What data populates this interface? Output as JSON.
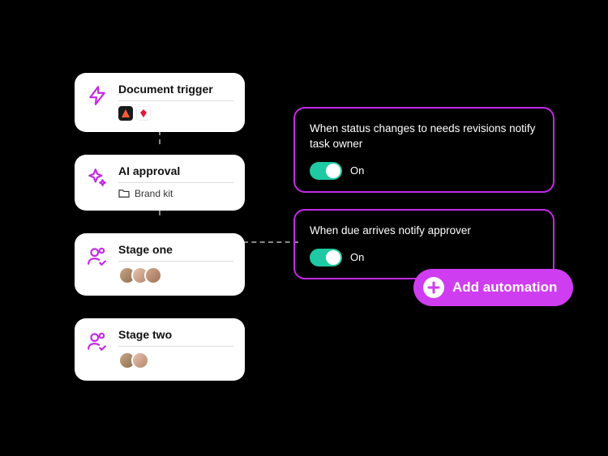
{
  "colors": {
    "accent": "#c528e8",
    "toggle_on": "#1ec9a3",
    "pill": "#cf3df0"
  },
  "stages": [
    {
      "title": "Document trigger",
      "icon": "lightning-icon",
      "meta_type": "apps"
    },
    {
      "title": "AI approval",
      "icon": "sparkle-icon",
      "meta_type": "folder",
      "meta_label": "Brand kit"
    },
    {
      "title": "Stage one",
      "icon": "user-check-icon",
      "meta_type": "avatars",
      "avatar_count": 3
    },
    {
      "title": "Stage two",
      "icon": "user-check-icon",
      "meta_type": "avatars",
      "avatar_count": 2
    }
  ],
  "automations": [
    {
      "rule": "When status changes to needs revisions notify task owner",
      "toggle_state": "On"
    },
    {
      "rule": "When due arrives notify approver",
      "toggle_state": "On"
    }
  ],
  "add_button": {
    "label": "Add automation"
  }
}
